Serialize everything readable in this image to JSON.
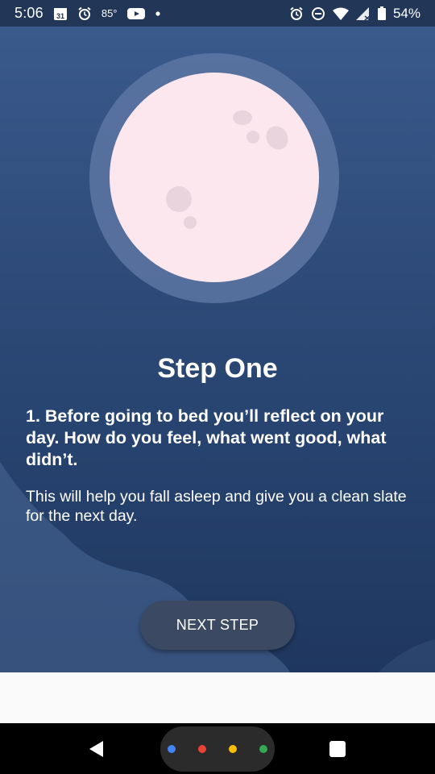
{
  "status_bar": {
    "time": "5:06",
    "calendar_day": "31",
    "temperature": "85°",
    "battery": "54%",
    "icons": [
      "calendar-icon",
      "alarm-icon",
      "youtube-icon",
      "notification-dot-icon",
      "alarm-icon",
      "do-not-disturb-icon",
      "wifi-icon",
      "signal-icon",
      "battery-icon"
    ]
  },
  "content": {
    "title": "Step One",
    "step_text": "1. Before going to bed you’ll reflect on your day. How do you feel, what went good, what didn’t.",
    "body_text": "This will help you fall asleep and give you a clean slate for the next day.",
    "next_button_label": "NEXT STEP"
  },
  "nav_bar": {
    "assistant_dot_colors": [
      "#4285f4",
      "#ea4335",
      "#fbbc05",
      "#34a853"
    ]
  },
  "colors": {
    "background_top": "#3a5a8c",
    "background_bottom": "#1f375f",
    "moon": "#fde7ef",
    "moon_halo": "#5d76a3",
    "button": "#3b4a62"
  }
}
